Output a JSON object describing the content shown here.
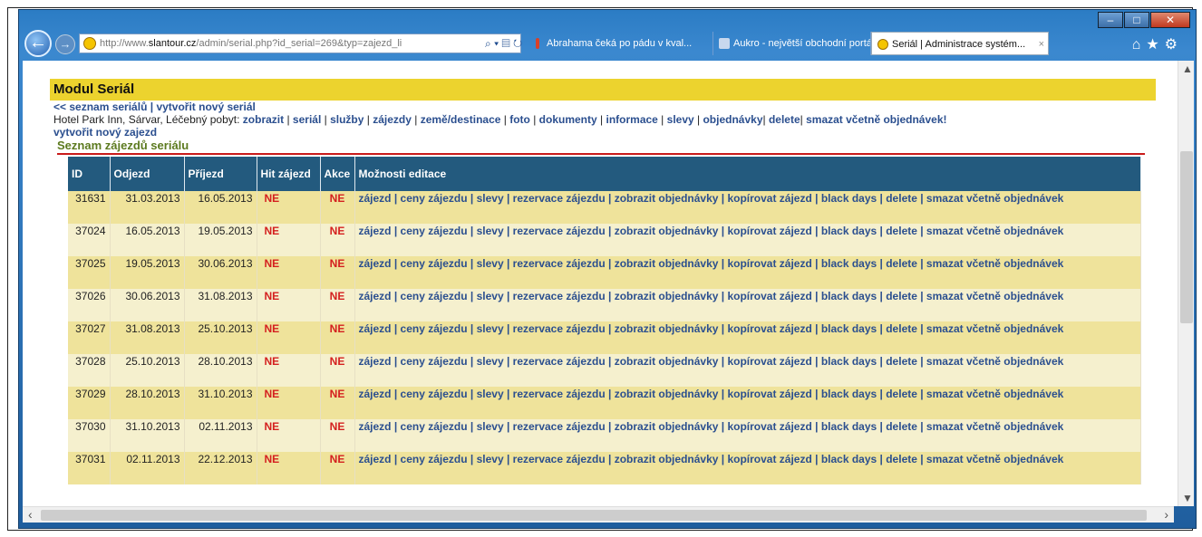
{
  "browser": {
    "url_prefix": "http://www.",
    "url_host": "slantour.cz",
    "url_rest": "/admin/serial.php?id_serial=269&typ=zajezd_li",
    "tabs": [
      {
        "label": "Abrahama čeká po pádu v kval..."
      },
      {
        "label": "Aukro - největší obchodní portál"
      },
      {
        "label": "Seriál | Administrace systém..."
      }
    ]
  },
  "page": {
    "module_title": "Modul Seriál",
    "nav_list": "<< seznam seriálů",
    "nav_sep": " | ",
    "nav_new": "vytvořit nový seriál",
    "serial_name": "Hotel Park Inn, Sárvar, Léčebný pobyt: ",
    "serial_links": [
      "zobrazit",
      "seriál",
      "služby",
      "zájezdy",
      "země/destinace",
      "foto",
      "dokumenty",
      "informace",
      "slevy",
      "objednávky",
      "delete",
      "smazat včetně objednávek!"
    ],
    "new_trip": "vytvořit nový zajezd",
    "section_title": "Seznam zájezdů seriálu",
    "columns": [
      "ID",
      "Odjezd",
      "Příjezd",
      "Hit zájezd",
      "Akce",
      "Možnosti editace"
    ],
    "ops_text": "zájezd | ceny zájezdu | slevy | rezervace zájezdu | zobrazit objednávky | kopírovat zájezd | black days | delete | smazat včetně objednávek",
    "rows": [
      {
        "id": "31631",
        "odjezd": "31.03.2013",
        "prijezd": "16.05.2013",
        "hit": "NE",
        "akce": "NE"
      },
      {
        "id": "37024",
        "odjezd": "16.05.2013",
        "prijezd": "19.05.2013",
        "hit": "NE",
        "akce": "NE"
      },
      {
        "id": "37025",
        "odjezd": "19.05.2013",
        "prijezd": "30.06.2013",
        "hit": "NE",
        "akce": "NE"
      },
      {
        "id": "37026",
        "odjezd": "30.06.2013",
        "prijezd": "31.08.2013",
        "hit": "NE",
        "akce": "NE"
      },
      {
        "id": "37027",
        "odjezd": "31.08.2013",
        "prijezd": "25.10.2013",
        "hit": "NE",
        "akce": "NE"
      },
      {
        "id": "37028",
        "odjezd": "25.10.2013",
        "prijezd": "28.10.2013",
        "hit": "NE",
        "akce": "NE"
      },
      {
        "id": "37029",
        "odjezd": "28.10.2013",
        "prijezd": "31.10.2013",
        "hit": "NE",
        "akce": "NE"
      },
      {
        "id": "37030",
        "odjezd": "31.10.2013",
        "prijezd": "02.11.2013",
        "hit": "NE",
        "akce": "NE"
      },
      {
        "id": "37031",
        "odjezd": "02.11.2013",
        "prijezd": "22.12.2013",
        "hit": "NE",
        "akce": "NE"
      }
    ]
  }
}
